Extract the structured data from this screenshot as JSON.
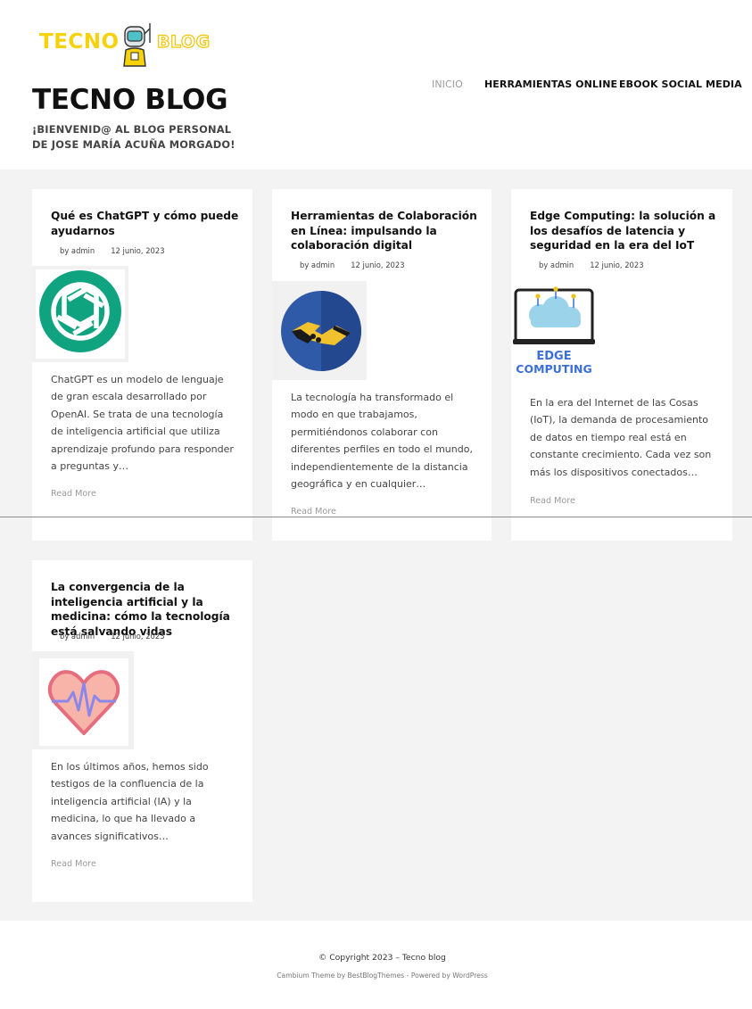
{
  "site": {
    "logo_text_left": "TECNO",
    "logo_text_right": "BLOG",
    "title": "TECNO BLOG",
    "description": "¡BIENVENID@ AL BLOG PERSONAL DE JOSE MARÍA ACUÑA MORGADO!"
  },
  "nav": {
    "items": [
      {
        "label": "INICIO",
        "active": true
      },
      {
        "label": "HERRAMIENTAS ONLINE"
      },
      {
        "label": "EBOOK SOCIAL MEDIA"
      }
    ]
  },
  "posts": [
    {
      "title": "Qué es ChatGPT y cómo puede ayudarnos",
      "author": "by admin",
      "date": "12 junio, 2023",
      "image_icon": "openai-logo-icon",
      "excerpt": "ChatGPT es un modelo de lenguaje de gran escala desarrollado por OpenAI. Se trata de una tecnología de inteligencia artificial que utiliza aprendizaje profundo para responder a preguntas y…",
      "read_more": "Read More"
    },
    {
      "title": "Herramientas de Colaboración en Línea: impulsando la colaboración digital",
      "author": "by admin",
      "date": "12 junio, 2023",
      "image_icon": "handshake-icon",
      "excerpt": "La tecnología ha transformado el modo en que trabajamos, permitiéndonos colaborar con diferentes perfiles en todo el mundo, independientemente de la distancia geográfica y en cualquier…",
      "read_more": "Read More"
    },
    {
      "title": "Edge Computing: la solución a los desafíos de latencia y seguridad en la era del IoT",
      "author": "by admin",
      "date": "12 junio, 2023",
      "image_icon": "edge-computing-icon",
      "image_caption_1": "EDGE",
      "image_caption_2": "COMPUTING",
      "excerpt": "En la era del Internet de las Cosas (IoT), la demanda de procesamiento de datos en tiempo real está en constante crecimiento. Cada vez son más los dispositivos conectados…",
      "read_more": "Read More"
    },
    {
      "title": "La convergencia de la inteligencia artificial y la medicina: cómo la tecnología está salvando vidas",
      "author": "by admin",
      "date": "12 junio, 2023",
      "image_icon": "heartbeat-icon",
      "excerpt": "En los últimos años, hemos sido testigos de la confluencia de la inteligencia artificial (IA) y la medicina, lo que ha llevado a avances significativos…",
      "read_more": "Read More"
    }
  ],
  "footer": {
    "copyright": "© Copyright 2023 – Tecno blog",
    "theme_label": "Cambium Theme",
    "by_label": " by ",
    "theme_author": "BestBlogThemes",
    "powered_label": " - Powered by ",
    "platform": "WordPress"
  },
  "colors": {
    "accent_yellow": "#f5d20b",
    "page_bg": "#f3f3f3",
    "openai_green": "#10a37f",
    "handshake_blue": "#2f5aa8",
    "edge_blue": "#3b6fd8",
    "heart_pink": "#f08c8c"
  }
}
